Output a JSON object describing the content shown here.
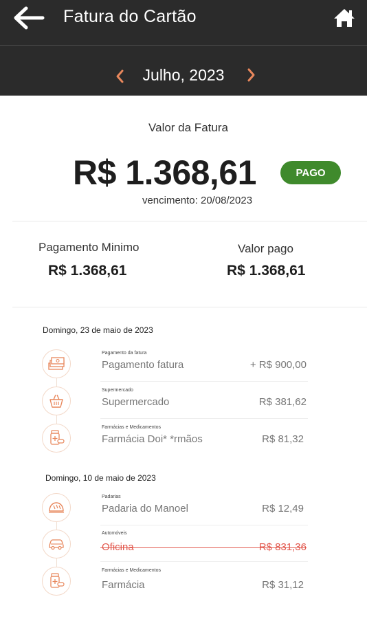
{
  "header": {
    "title": "Fatura do Cartão",
    "back_icon": "arrow-left-icon",
    "home_icon": "home-icon"
  },
  "month_nav": {
    "label": "Julho, 2023",
    "prev_icon": "chevron-left-icon",
    "next_icon": "chevron-right-icon"
  },
  "summary": {
    "caption": "Valor da Fatura",
    "amount": "R$ 1.368,61",
    "status": "PAGO",
    "due_date": "vencimento: 20/08/2023",
    "min_payment_label": "Pagamento Minimo",
    "min_payment_value": "R$ 1.368,61",
    "paid_label": "Valor pago",
    "paid_value": "R$ 1.368,61"
  },
  "colors": {
    "header_bg": "#2b2b2b",
    "accent": "#e8875c",
    "badge_green": "#3f8a2c",
    "cancelled_red": "#e2574c"
  },
  "groups": [
    {
      "date": "Domingo, 23 de maio de 2023",
      "items": [
        {
          "category": "Pagamento da fatura",
          "name": "Pagamento  fatura",
          "amount": "+ R$ 900,00",
          "icon": "money-stack-icon",
          "cancelled": false
        },
        {
          "category": "Supermercado",
          "name": "Supermercado",
          "amount": "R$ 381,62",
          "icon": "shopping-basket-icon",
          "cancelled": false
        },
        {
          "category": "Farmácias e Medicamentos",
          "name": "Farmácia Doi* *rmãos",
          "amount": "R$  81,32",
          "icon": "medicine-icon",
          "cancelled": false
        }
      ]
    },
    {
      "date": "Domingo, 10 de maio de 2023",
      "items": [
        {
          "category": "Padarias",
          "name": "Padaria do Manoel",
          "amount": "R$  12,49",
          "icon": "bread-icon",
          "cancelled": false
        },
        {
          "category": "Automóveis",
          "name": "Oficina",
          "amount": "R$ 831,36",
          "icon": "car-icon",
          "cancelled": true
        },
        {
          "category": "Farmácias e Medicamentos",
          "name": "Farmácia",
          "amount": "R$  31,12",
          "icon": "medicine-icon",
          "cancelled": false
        }
      ]
    }
  ]
}
